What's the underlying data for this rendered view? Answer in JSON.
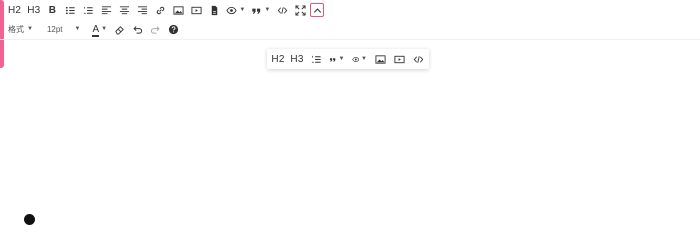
{
  "toolbar_row1": {
    "h2": "H2",
    "h3": "H3",
    "bold": "B"
  },
  "toolbar_row2": {
    "format_select": "格式",
    "size_select": "12pt",
    "font_color_letter": "A"
  },
  "floating_toolbar": {
    "h2": "H2",
    "h3": "H3"
  },
  "icons": [
    "bold-icon",
    "unordered-list-icon",
    "ordered-list-icon",
    "align-left-icon",
    "align-center-icon",
    "align-right-icon",
    "link-icon",
    "image-icon",
    "video-icon",
    "file-icon",
    "eye-icon",
    "quote-icon",
    "code-icon",
    "fullscreen-icon",
    "chevron-up-icon",
    "eraser-icon",
    "undo-icon",
    "redo-icon",
    "help-icon"
  ],
  "colors": {
    "accent": "#f06292",
    "active_border": "#e05a7a",
    "icon": "#333333"
  }
}
